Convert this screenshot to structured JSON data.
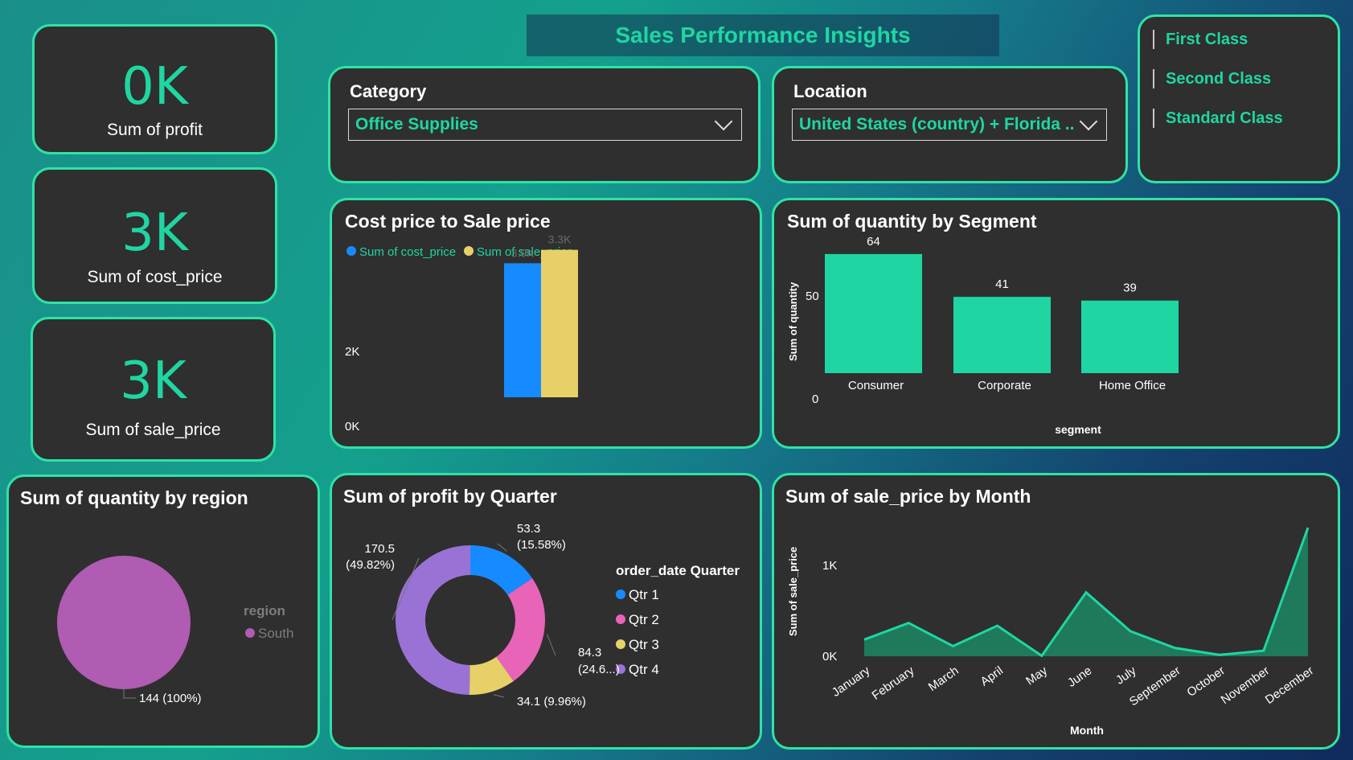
{
  "header": {
    "title": "Sales Performance Insights"
  },
  "kpis": [
    {
      "value": "0K",
      "label": "Sum of profit"
    },
    {
      "value": "3K",
      "label": "Sum of cost_price"
    },
    {
      "value": "3K",
      "label": "Sum of sale_price"
    }
  ],
  "slicers": {
    "category": {
      "title": "Category",
      "value": "Office Supplies"
    },
    "location": {
      "title": "Location",
      "value": "United States (country) + Florida ..."
    },
    "ship_modes": [
      "First Class",
      "Second Class",
      "Standard Class"
    ]
  },
  "colors": {
    "accent": "#1fd6a2",
    "border": "#2ee3a6",
    "card": "#2f2f2f",
    "cost": "#168bff",
    "sale": "#e8d069",
    "pie": "#b05cb2",
    "q1": "#168bff",
    "q2": "#e864b8",
    "q3": "#e8d069",
    "q4": "#9a72d6",
    "area": "#1f7a5c"
  },
  "chart_data": [
    {
      "id": "cost-vs-sale",
      "type": "bar",
      "title": "Cost price to Sale price",
      "series": [
        {
          "name": "Sum of cost_price",
          "values": [
            3000
          ]
        },
        {
          "name": "Sum of sale_price",
          "values": [
            3300
          ]
        }
      ],
      "data_labels": [
        "3.0K",
        "3.3K"
      ],
      "yticks": [
        "0K",
        "2K"
      ],
      "ylim": [
        0,
        3600
      ],
      "legend": "top-left"
    },
    {
      "id": "qty-by-segment",
      "type": "bar",
      "title": "Sum of quantity by Segment",
      "categories": [
        "Consumer",
        "Corporate",
        "Home Office"
      ],
      "values": [
        64,
        41,
        39
      ],
      "xlabel": "segment",
      "ylabel": "Sum of quantity",
      "yticks": [
        "0",
        "50"
      ],
      "ylim": [
        0,
        70
      ]
    },
    {
      "id": "qty-by-region",
      "type": "pie",
      "title": "Sum of quantity by region",
      "legend_title": "region",
      "categories": [
        "South"
      ],
      "values": [
        144
      ],
      "data_labels": [
        "144 (100%)"
      ]
    },
    {
      "id": "profit-by-quarter",
      "type": "pie",
      "title": "Sum of profit by Quarter",
      "legend_title": "order_date Quarter",
      "categories": [
        "Qtr 1",
        "Qtr 2",
        "Qtr 3",
        "Qtr 4"
      ],
      "values": [
        53.3,
        84.3,
        34.1,
        170.5
      ],
      "data_labels": [
        {
          "value": "53.3",
          "pct": "(15.58%)"
        },
        {
          "value": "84.3",
          "pct": "(24.6...)"
        },
        {
          "value": "34.1 (9.96%)",
          "pct": ""
        },
        {
          "value": "170.5",
          "pct": "(49.82%)"
        }
      ]
    },
    {
      "id": "sale-by-month",
      "type": "area",
      "title": "Sum of sale_price by Month",
      "xlabel": "Month",
      "ylabel": "Sum of sale_price",
      "categories": [
        "January",
        "February",
        "March",
        "April",
        "May",
        "June",
        "July",
        "September",
        "October",
        "November",
        "December"
      ],
      "values": [
        180,
        360,
        110,
        330,
        5,
        690,
        270,
        90,
        15,
        60,
        1390
      ],
      "yticks": [
        "0K",
        "1K"
      ],
      "ylim": [
        0,
        1500
      ]
    }
  ]
}
